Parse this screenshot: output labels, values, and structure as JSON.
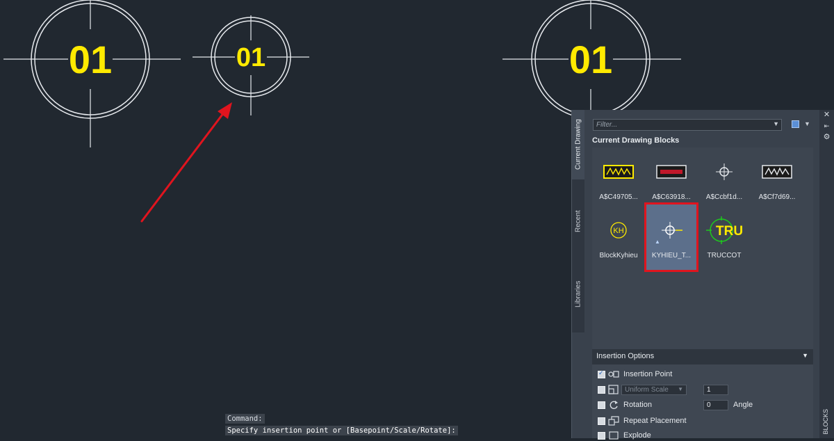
{
  "drawing": {
    "circle_labels": [
      "01",
      "01",
      "01"
    ]
  },
  "command_line": {
    "line1": "Command:",
    "line2": "Specify insertion point or [Basepoint/Scale/Rotate]:"
  },
  "palette": {
    "tabs": [
      "Current Drawing",
      "Recent",
      "Libraries"
    ],
    "active_tab": "Current Drawing",
    "filter_placeholder": "Filter...",
    "section_title": "Current Drawing Blocks",
    "blocks": [
      {
        "name": "A$C49705...",
        "icon": "title-block-thumbnail"
      },
      {
        "name": "A$C63918...",
        "icon": "frame-thumbnail"
      },
      {
        "name": "A$Ccbf1d...",
        "icon": "crosshair-thumbnail"
      },
      {
        "name": "A$Cf7d69...",
        "icon": "title-block-thumbnail"
      },
      {
        "name": "BlockKyhieu",
        "icon": "kh-circle-thumbnail"
      },
      {
        "name": "KYHIEU_T...",
        "icon": "crosshair-thumbnail",
        "selected": true
      },
      {
        "name": "TRUCCOT",
        "icon": "truccot-thumbnail"
      }
    ],
    "insertion_options": {
      "header": "Insertion Options",
      "insertion_point": {
        "label": "Insertion Point",
        "checked": true
      },
      "uniform_scale": {
        "label": "Uniform Scale",
        "value": "1",
        "checked": false
      },
      "rotation": {
        "label": "Rotation",
        "value": "0",
        "unit_label": "Angle",
        "checked": false
      },
      "repeat_placement": {
        "label": "Repeat Placement",
        "checked": false
      },
      "explode": {
        "label": "Explode",
        "checked": false
      }
    },
    "side_label": "BLOCKS"
  },
  "colors": {
    "canvas": "#212830",
    "highlight": "#e0141e",
    "annotation_arrow": "#e0141e",
    "block_text": "#ffea00"
  }
}
